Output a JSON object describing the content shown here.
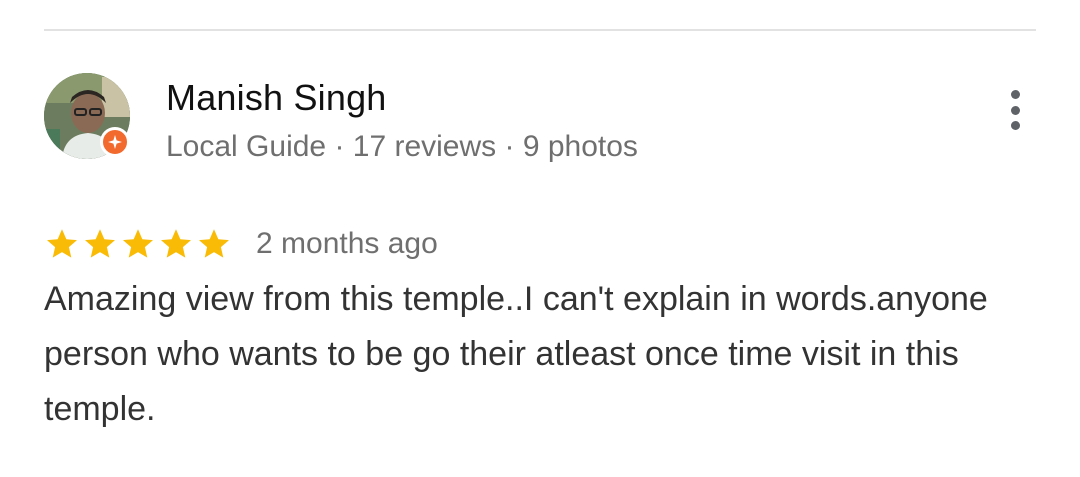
{
  "review": {
    "author": {
      "name": "Manish Singh",
      "meta": "Local Guide · 17 reviews · 9 photos",
      "avatar_icon": "user-avatar",
      "badge_icon": "local-guide-badge-icon",
      "badge_color": "#f26a2e"
    },
    "rating": {
      "stars": 5,
      "max_stars": 5,
      "star_color": "#f9bb05"
    },
    "time_ago": "2 months ago",
    "text": "Amazing view from this temple..I can't explain in words.anyone person who wants to be go their atleast once time visit in this temple.",
    "menu_icon": "more-vert-icon"
  }
}
